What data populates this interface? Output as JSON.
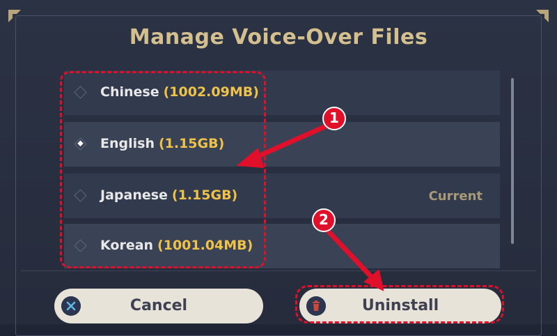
{
  "dialog": {
    "title": "Manage Voice-Over Files"
  },
  "languages": [
    {
      "name": "Chinese",
      "size": "(1002.09MB)",
      "selected": false,
      "status": ""
    },
    {
      "name": "English",
      "size": "(1.15GB)",
      "selected": true,
      "status": ""
    },
    {
      "name": "Japanese",
      "size": "(1.15GB)",
      "selected": false,
      "status": "Current"
    },
    {
      "name": "Korean",
      "size": "(1001.04MB)",
      "selected": false,
      "status": ""
    }
  ],
  "buttons": {
    "cancel": "Cancel",
    "uninstall": "Uninstall"
  },
  "annotations": {
    "step1": "1",
    "step2": "2"
  },
  "colors": {
    "accent_gold": "#efc24a",
    "title": "#d4bf8e",
    "highlight": "#e0102a",
    "button_bg": "#e8e3d8"
  },
  "icons": {
    "cancel": "close-circle-icon",
    "uninstall": "trash-icon"
  }
}
